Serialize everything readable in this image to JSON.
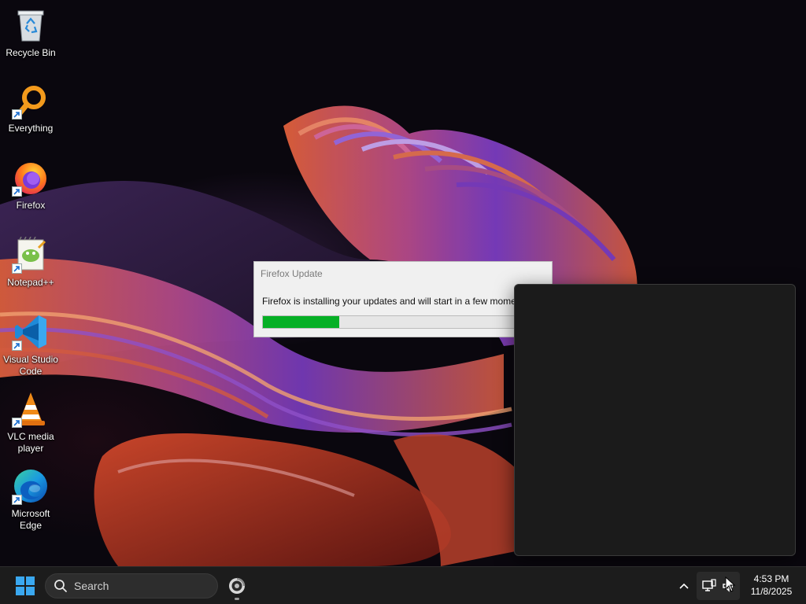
{
  "desktop": {
    "icons": [
      {
        "label": "Recycle Bin",
        "icon": "recycle-bin-icon",
        "shortcut": false
      },
      {
        "label": "Everything",
        "icon": "everything-search-icon",
        "shortcut": true
      },
      {
        "label": "Firefox",
        "icon": "firefox-icon",
        "shortcut": true
      },
      {
        "label": "Notepad++",
        "icon": "notepad-plus-plus-icon",
        "shortcut": true
      },
      {
        "label": "Visual Studio Code",
        "icon": "vscode-icon",
        "shortcut": true
      },
      {
        "label": "VLC media player",
        "icon": "vlc-icon",
        "shortcut": true
      },
      {
        "label": "Microsoft Edge",
        "icon": "edge-icon",
        "shortcut": true
      }
    ]
  },
  "update_dialog": {
    "title": "Firefox Update",
    "message": "Firefox is installing your updates and will start in a few moments...",
    "progress_fraction": 0.27,
    "progress_color": "#06b025"
  },
  "taskbar": {
    "search_placeholder": "Search",
    "pinned_app_icon": "firefox-update-app-icon",
    "tray_icons": [
      "chevron-up-icon",
      "network-icon",
      "volume-icon"
    ],
    "clock_time": "4:53 PM",
    "clock_date": "11/8/2025"
  },
  "colors": {
    "taskbar_bg": "#1c1c1c",
    "accent_windows_blue": "#2aa7f0",
    "panel_bg": "#1b1b1b"
  }
}
